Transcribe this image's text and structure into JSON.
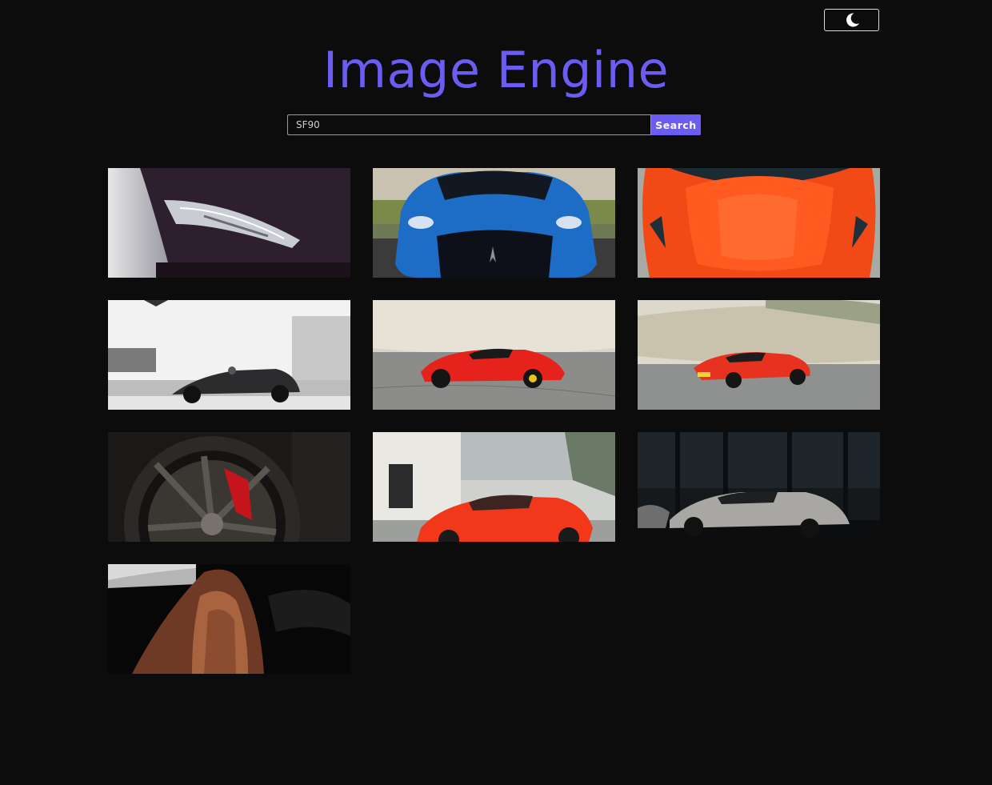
{
  "header": {
    "title": "Image Engine",
    "theme_toggle_icon": "moon-icon"
  },
  "search": {
    "value": "SF90",
    "button_label": "Search"
  },
  "colors": {
    "accent": "#6b5cf2",
    "background": "#0c0c0c"
  },
  "results": [
    {
      "subject": "dark car headlight close-up"
    },
    {
      "subject": "blue sports car front view"
    },
    {
      "subject": "orange car hood top view"
    },
    {
      "subject": "black convertible in motion, monochrome"
    },
    {
      "subject": "red sports car on beach road"
    },
    {
      "subject": "red sports car rear on beach road"
    },
    {
      "subject": "wheel with red brake caliper"
    },
    {
      "subject": "red sports car parked by building"
    },
    {
      "subject": "silver sports car in showroom"
    },
    {
      "subject": "brown leather car seat"
    }
  ]
}
